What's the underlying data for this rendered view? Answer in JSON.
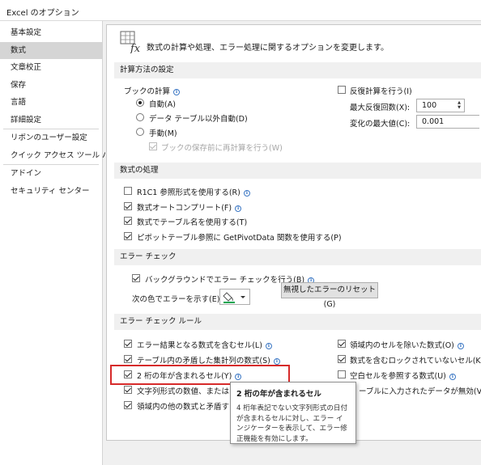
{
  "window": {
    "title": "Excel のオプション"
  },
  "sidebar": {
    "items": [
      {
        "label": "基本設定"
      },
      {
        "label": "数式"
      },
      {
        "label": "文章校正"
      },
      {
        "label": "保存"
      },
      {
        "label": "言語"
      },
      {
        "label": "詳細設定"
      },
      {
        "label": "リボンのユーザー設定"
      },
      {
        "label": "クイック アクセス ツール バー"
      },
      {
        "label": "アドイン"
      },
      {
        "label": "セキュリティ センター"
      }
    ],
    "active_index": 1
  },
  "header": {
    "text": "数式の計算や処理、エラー処理に関するオプションを変更します。",
    "icon": "fx-formula-icon"
  },
  "calc": {
    "section_title": "計算方法の設定",
    "workbook_label": "ブックの計算",
    "auto_label": "自動(A)",
    "auto_except_label": "データ テーブル以外自動(D)",
    "manual_label": "手動(M)",
    "recalc_before_save_label": "ブックの保存前に再計算を行う(W)",
    "iterative_label": "反復計算を行う(I)",
    "max_iter_label": "最大反復回数(X):",
    "max_iter_value": "100",
    "max_change_label": "変化の最大値(C):",
    "max_change_value": "0.001",
    "selected": "auto"
  },
  "formulas": {
    "section_title": "数式の処理",
    "r1c1_label": "R1C1 参照形式を使用する(R)",
    "autocomplete_label": "数式オートコンプリート(F)",
    "table_names_label": "数式でテーブル名を使用する(T)",
    "getpivotdata_label": "ピボットテーブル参照に GetPivotData 関数を使用する(P)"
  },
  "error_check": {
    "section_title": "エラー チェック",
    "background_label": "バックグラウンドでエラー チェックを行う(B)",
    "color_label": "次の色でエラーを示す(E):",
    "reset_button": "無視したエラーのリセット(G)",
    "indicator_color": "#00a651"
  },
  "rules": {
    "section_title": "エラー チェック ルール",
    "left": [
      {
        "label": "エラー結果となる数式を含むセル(L)"
      },
      {
        "label": "テーブル内の矛盾した集計列の数式(S)"
      },
      {
        "label": "2 桁の年が含まれるセル(Y)"
      },
      {
        "label": "文字列形式の数値、またはアポ"
      },
      {
        "label": "領域内の他の数式と矛盾する"
      }
    ],
    "right": [
      {
        "label": "領域内のセルを除いた数式(O)"
      },
      {
        "label": "数式を含むロックされていないセル(K)"
      },
      {
        "label": "空白セルを参照する数式(U)"
      },
      {
        "label": "ーブルに入力されたデータが無効(V)"
      }
    ]
  },
  "tooltip": {
    "title": "2 桁の年が含まれるセル",
    "body": "4 桁年表記でない文字列形式の日付が含まれるセルに対し、エラー インジケーターを表示して、エラー修正機能を有効にします。"
  },
  "icons": {
    "info": "info-icon",
    "checkmark": "checkmark-icon",
    "paint_bucket": "paint-bucket-icon"
  }
}
